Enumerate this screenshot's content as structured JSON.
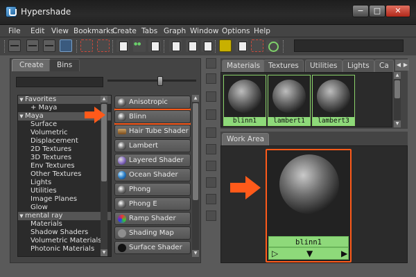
{
  "window": {
    "title": "Hypershade",
    "buttons": {
      "minimize": "−",
      "maximize": "□",
      "close": "✕"
    }
  },
  "menu": [
    "File",
    "Edit",
    "View",
    "Bookmarks",
    "Create",
    "Tabs",
    "Graph",
    "Window",
    "Options",
    "Help"
  ],
  "left_tabs": {
    "create": "Create",
    "bins": "Bins"
  },
  "slider_level": 0.6,
  "tree": {
    "items": [
      {
        "label": "Favorites",
        "type": "cat",
        "arrow": "▼"
      },
      {
        "label": "+ Maya",
        "type": "item"
      },
      {
        "label": "Maya",
        "type": "cat",
        "arrow": "▼"
      },
      {
        "label": "Surface",
        "type": "item"
      },
      {
        "label": "Volumetric",
        "type": "item"
      },
      {
        "label": "Displacement",
        "type": "item"
      },
      {
        "label": "2D Textures",
        "type": "item"
      },
      {
        "label": "3D Textures",
        "type": "item"
      },
      {
        "label": "Env Textures",
        "type": "item"
      },
      {
        "label": "Other Textures",
        "type": "item"
      },
      {
        "label": "Lights",
        "type": "item"
      },
      {
        "label": "Utilities",
        "type": "item"
      },
      {
        "label": "Image Planes",
        "type": "item"
      },
      {
        "label": "Glow",
        "type": "item"
      },
      {
        "label": "mental ray",
        "type": "cat",
        "arrow": "▼"
      },
      {
        "label": "Materials",
        "type": "item"
      },
      {
        "label": "Shadow Shaders",
        "type": "item"
      },
      {
        "label": "Volumetric Materials",
        "type": "item"
      },
      {
        "label": "Photonic Materials",
        "type": "item"
      }
    ]
  },
  "shaders": [
    {
      "label": "Anisotropic",
      "icon": "grey"
    },
    {
      "label": "Blinn",
      "icon": "grey",
      "highlighted": true
    },
    {
      "label": "Hair Tube Shader",
      "icon": "hair"
    },
    {
      "label": "Lambert",
      "icon": "grey"
    },
    {
      "label": "Layered Shader",
      "icon": "layer"
    },
    {
      "label": "Ocean Shader",
      "icon": "ocean"
    },
    {
      "label": "Phong",
      "icon": "grey"
    },
    {
      "label": "Phong E",
      "icon": "grey"
    },
    {
      "label": "Ramp Shader",
      "icon": "ramp"
    },
    {
      "label": "Shading Map",
      "icon": "map"
    },
    {
      "label": "Surface Shader",
      "icon": "surf"
    }
  ],
  "material_tabs": [
    "Materials",
    "Textures",
    "Utilities",
    "Lights",
    "Ca"
  ],
  "materials": [
    "blinn1",
    "lambert1",
    "lambert3"
  ],
  "work_area": {
    "tab": "Work Area",
    "node_label": "blinn1",
    "port_left": "▷",
    "port_mid": "▼",
    "port_right": "▶"
  },
  "colors": {
    "highlight": "#ff5a1a",
    "swatch_label": "#8ed97a",
    "arrow": "#ff5a1a"
  }
}
